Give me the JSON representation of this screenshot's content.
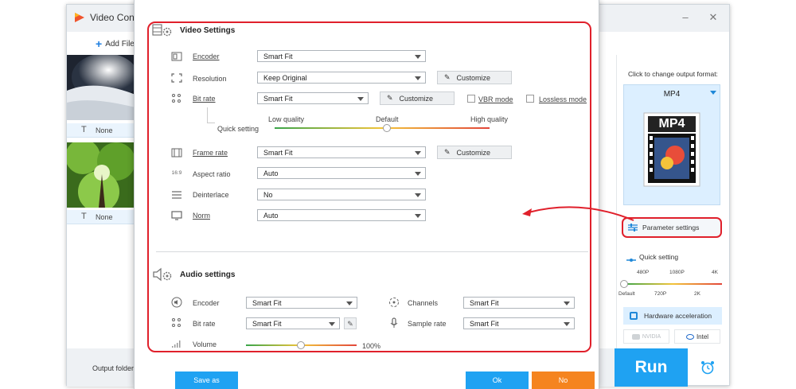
{
  "app": {
    "title": "Video Conv",
    "add_files": "Add File"
  },
  "file_list": [
    {
      "subtitle": "None"
    },
    {
      "subtitle": "None"
    }
  ],
  "output_folder_label": "Output folder:",
  "right_panel": {
    "format_prompt": "Click to change output format:",
    "format_name": "MP4",
    "format_icon_text": "MP4",
    "param_settings": "Parameter settings",
    "quick_setting": "Quick setting",
    "quality_top": [
      "480P",
      "1080P",
      "4K"
    ],
    "quality_bottom": [
      "Default",
      "720P",
      "2K"
    ],
    "hw_accel": "Hardware acceleration",
    "nvidia": "NVIDIA",
    "intel": "Intel",
    "run": "Run"
  },
  "video": {
    "title": "Video Settings",
    "encoder": {
      "label": "Encoder",
      "value": "Smart Fit"
    },
    "resolution": {
      "label": "Resolution",
      "value": "Keep Original",
      "customize": "Customize"
    },
    "bitrate": {
      "label": "Bit rate",
      "value": "Smart Fit",
      "customize": "Customize",
      "vbr": "VBR mode",
      "lossless": "Lossless mode"
    },
    "quick": {
      "label": "Quick setting",
      "low": "Low quality",
      "default": "Default",
      "high": "High quality"
    },
    "framerate": {
      "label": "Frame rate",
      "value": "Smart Fit",
      "customize": "Customize"
    },
    "aspect": {
      "label": "Aspect ratio",
      "value": "Auto",
      "icon_text": "16:9"
    },
    "deinterlace": {
      "label": "Deinterlace",
      "value": "No"
    },
    "norm": {
      "label": "Norm",
      "value": "Auto"
    }
  },
  "audio": {
    "title": "Audio settings",
    "encoder": {
      "label": "Encoder",
      "value": "Smart Fit"
    },
    "bitrate": {
      "label": "Bit rate",
      "value": "Smart Fit"
    },
    "channels": {
      "label": "Channels",
      "value": "Smart Fit"
    },
    "samplerate": {
      "label": "Sample rate",
      "value": "Smart Fit"
    },
    "volume": {
      "label": "Volume",
      "value": "100%"
    }
  },
  "dialog_buttons": {
    "save_as": "Save as",
    "ok": "Ok",
    "no": "No"
  },
  "colors": {
    "accent": "#1fa2f2",
    "red_highlight": "#e0202b",
    "no_button": "#f5841f"
  }
}
